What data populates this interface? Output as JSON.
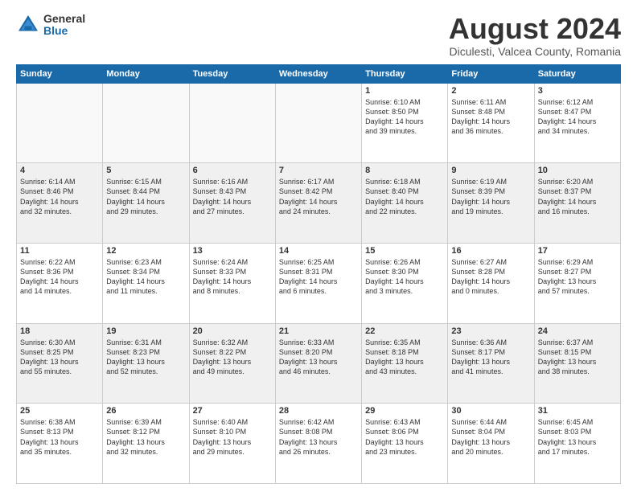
{
  "logo": {
    "general": "General",
    "blue": "Blue"
  },
  "title": "August 2024",
  "subtitle": "Diculesti, Valcea County, Romania",
  "days": [
    "Sunday",
    "Monday",
    "Tuesday",
    "Wednesday",
    "Thursday",
    "Friday",
    "Saturday"
  ],
  "weeks": [
    [
      {
        "day": "",
        "text": ""
      },
      {
        "day": "",
        "text": ""
      },
      {
        "day": "",
        "text": ""
      },
      {
        "day": "",
        "text": ""
      },
      {
        "day": "1",
        "text": "Sunrise: 6:10 AM\nSunset: 8:50 PM\nDaylight: 14 hours\nand 39 minutes."
      },
      {
        "day": "2",
        "text": "Sunrise: 6:11 AM\nSunset: 8:48 PM\nDaylight: 14 hours\nand 36 minutes."
      },
      {
        "day": "3",
        "text": "Sunrise: 6:12 AM\nSunset: 8:47 PM\nDaylight: 14 hours\nand 34 minutes."
      }
    ],
    [
      {
        "day": "4",
        "text": "Sunrise: 6:14 AM\nSunset: 8:46 PM\nDaylight: 14 hours\nand 32 minutes."
      },
      {
        "day": "5",
        "text": "Sunrise: 6:15 AM\nSunset: 8:44 PM\nDaylight: 14 hours\nand 29 minutes."
      },
      {
        "day": "6",
        "text": "Sunrise: 6:16 AM\nSunset: 8:43 PM\nDaylight: 14 hours\nand 27 minutes."
      },
      {
        "day": "7",
        "text": "Sunrise: 6:17 AM\nSunset: 8:42 PM\nDaylight: 14 hours\nand 24 minutes."
      },
      {
        "day": "8",
        "text": "Sunrise: 6:18 AM\nSunset: 8:40 PM\nDaylight: 14 hours\nand 22 minutes."
      },
      {
        "day": "9",
        "text": "Sunrise: 6:19 AM\nSunset: 8:39 PM\nDaylight: 14 hours\nand 19 minutes."
      },
      {
        "day": "10",
        "text": "Sunrise: 6:20 AM\nSunset: 8:37 PM\nDaylight: 14 hours\nand 16 minutes."
      }
    ],
    [
      {
        "day": "11",
        "text": "Sunrise: 6:22 AM\nSunset: 8:36 PM\nDaylight: 14 hours\nand 14 minutes."
      },
      {
        "day": "12",
        "text": "Sunrise: 6:23 AM\nSunset: 8:34 PM\nDaylight: 14 hours\nand 11 minutes."
      },
      {
        "day": "13",
        "text": "Sunrise: 6:24 AM\nSunset: 8:33 PM\nDaylight: 14 hours\nand 8 minutes."
      },
      {
        "day": "14",
        "text": "Sunrise: 6:25 AM\nSunset: 8:31 PM\nDaylight: 14 hours\nand 6 minutes."
      },
      {
        "day": "15",
        "text": "Sunrise: 6:26 AM\nSunset: 8:30 PM\nDaylight: 14 hours\nand 3 minutes."
      },
      {
        "day": "16",
        "text": "Sunrise: 6:27 AM\nSunset: 8:28 PM\nDaylight: 14 hours\nand 0 minutes."
      },
      {
        "day": "17",
        "text": "Sunrise: 6:29 AM\nSunset: 8:27 PM\nDaylight: 13 hours\nand 57 minutes."
      }
    ],
    [
      {
        "day": "18",
        "text": "Sunrise: 6:30 AM\nSunset: 8:25 PM\nDaylight: 13 hours\nand 55 minutes."
      },
      {
        "day": "19",
        "text": "Sunrise: 6:31 AM\nSunset: 8:23 PM\nDaylight: 13 hours\nand 52 minutes."
      },
      {
        "day": "20",
        "text": "Sunrise: 6:32 AM\nSunset: 8:22 PM\nDaylight: 13 hours\nand 49 minutes."
      },
      {
        "day": "21",
        "text": "Sunrise: 6:33 AM\nSunset: 8:20 PM\nDaylight: 13 hours\nand 46 minutes."
      },
      {
        "day": "22",
        "text": "Sunrise: 6:35 AM\nSunset: 8:18 PM\nDaylight: 13 hours\nand 43 minutes."
      },
      {
        "day": "23",
        "text": "Sunrise: 6:36 AM\nSunset: 8:17 PM\nDaylight: 13 hours\nand 41 minutes."
      },
      {
        "day": "24",
        "text": "Sunrise: 6:37 AM\nSunset: 8:15 PM\nDaylight: 13 hours\nand 38 minutes."
      }
    ],
    [
      {
        "day": "25",
        "text": "Sunrise: 6:38 AM\nSunset: 8:13 PM\nDaylight: 13 hours\nand 35 minutes."
      },
      {
        "day": "26",
        "text": "Sunrise: 6:39 AM\nSunset: 8:12 PM\nDaylight: 13 hours\nand 32 minutes."
      },
      {
        "day": "27",
        "text": "Sunrise: 6:40 AM\nSunset: 8:10 PM\nDaylight: 13 hours\nand 29 minutes."
      },
      {
        "day": "28",
        "text": "Sunrise: 6:42 AM\nSunset: 8:08 PM\nDaylight: 13 hours\nand 26 minutes."
      },
      {
        "day": "29",
        "text": "Sunrise: 6:43 AM\nSunset: 8:06 PM\nDaylight: 13 hours\nand 23 minutes."
      },
      {
        "day": "30",
        "text": "Sunrise: 6:44 AM\nSunset: 8:04 PM\nDaylight: 13 hours\nand 20 minutes."
      },
      {
        "day": "31",
        "text": "Sunrise: 6:45 AM\nSunset: 8:03 PM\nDaylight: 13 hours\nand 17 minutes."
      }
    ]
  ]
}
